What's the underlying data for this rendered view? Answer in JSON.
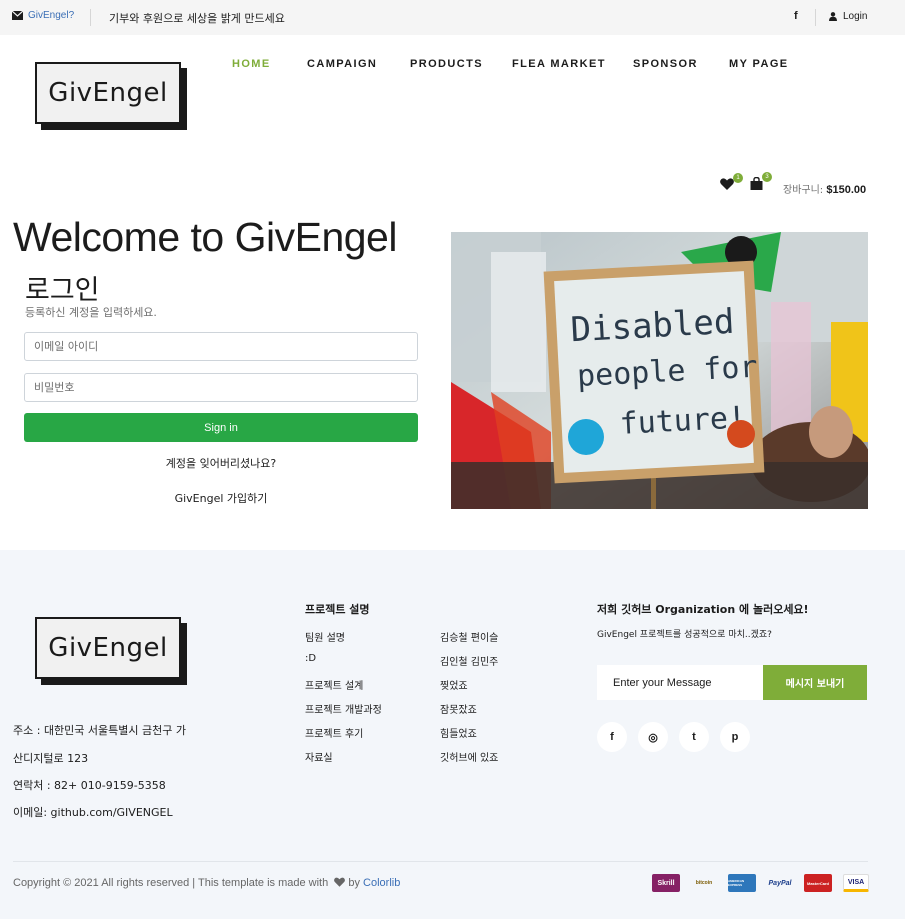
{
  "topbar": {
    "email_label": "GivEngel?",
    "motto": "기부와 후원으로 세상을 밝게 만드세요",
    "facebook_glyph": "f",
    "login_label": "Login"
  },
  "header": {
    "logo_text": "GivEngel",
    "nav": [
      "HOME",
      "CAMPAIGN",
      "PRODUCTS",
      "FLEA MARKET",
      "SPONSOR",
      "MY PAGE"
    ],
    "wishlist_count": "1",
    "cart_count": "3",
    "cart_label": "장바구니:",
    "cart_total": "$150.00"
  },
  "login": {
    "welcome": "Welcome to GivEngel",
    "title": "로그인",
    "subtitle": "등록하신 계정을 입력하세요.",
    "email_placeholder": "이메일 아이디",
    "password_placeholder": "비밀번호",
    "signin_label": "Sign in",
    "forgot_label": "계정을 잊어버리셨나요?",
    "join_label": "GivEngel 가입하기"
  },
  "hero": {
    "sign_line1": "Disabled",
    "sign_line2": "people for",
    "sign_line3": "future!",
    "colors": {
      "sign": "#e6ecec",
      "frame": "#c9a06a",
      "red": "#d8262a",
      "green": "#2aa84a",
      "yellow": "#f0c419"
    }
  },
  "footer": {
    "logo_text": "GivEngel",
    "address_lines": [
      "주소 : 대한민국 서울특별시 금천구 가",
      "산디지털로 123",
      "연락처 : 82+ 010-9159-5358",
      "이메일: github.com/GIVENGEL"
    ],
    "project_title": "프로젝트 설명",
    "links_col1": [
      "팀원 설명",
      ":D",
      "프로젝트 설계",
      "프로젝트 개발과정",
      "프로젝트 후기",
      "자료실"
    ],
    "links_col2": [
      "김승철 편이슬",
      "김인철 김민주",
      "찢었죠",
      "잠못잤죠",
      "힘들었죠",
      "깃허브에 있죠"
    ],
    "org_title": "저희 깃허브 Organization 에 놀러오세요!",
    "org_desc": "GivEngel 프로젝트를 성공적으로 마치..겠죠?",
    "message_placeholder": "Enter your Message",
    "send_label": "메시지 보내기",
    "social": [
      {
        "name": "facebook-icon",
        "glyph": "f"
      },
      {
        "name": "instagram-icon",
        "glyph": "◎"
      },
      {
        "name": "twitter-icon",
        "glyph": "t"
      },
      {
        "name": "pinterest-icon",
        "glyph": "p"
      }
    ],
    "copyright_text": "Copyright © 2021 All rights reserved | This template is made with",
    "copyright_by": " by ",
    "copyright_link": "Colorlib",
    "payments": [
      "Skrill",
      "bitcoin",
      "AMERICAN EXPRESS",
      "PayPal",
      "MasterCard",
      "VISA"
    ]
  },
  "colors": {
    "accent": "#7fad39",
    "signin": "#28a745",
    "footer_bg": "#f3f6fa",
    "link": "#3b6fb6"
  }
}
